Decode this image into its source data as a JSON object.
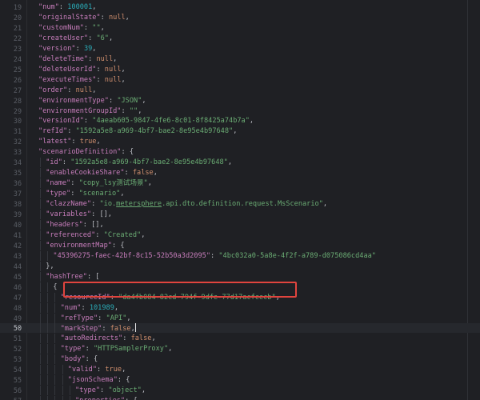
{
  "editor": {
    "language": "JSON",
    "current_line": 50,
    "lines": [
      {
        "n": 19,
        "indent": 0,
        "tokens": [
          [
            "k",
            "\"num\""
          ],
          [
            "p",
            ": "
          ],
          [
            "n",
            "100001"
          ],
          [
            "p",
            ","
          ]
        ]
      },
      {
        "n": 20,
        "indent": 0,
        "tokens": [
          [
            "k",
            "\"originalState\""
          ],
          [
            "p",
            ": "
          ],
          [
            "kw",
            "null"
          ],
          [
            "p",
            ","
          ]
        ]
      },
      {
        "n": 21,
        "indent": 0,
        "tokens": [
          [
            "k",
            "\"customNum\""
          ],
          [
            "p",
            ": "
          ],
          [
            "s",
            "\"\""
          ],
          [
            "p",
            ","
          ]
        ]
      },
      {
        "n": 22,
        "indent": 0,
        "tokens": [
          [
            "k",
            "\"createUser\""
          ],
          [
            "p",
            ": "
          ],
          [
            "s",
            "\"6\""
          ],
          [
            "p",
            ","
          ]
        ]
      },
      {
        "n": 23,
        "indent": 0,
        "tokens": [
          [
            "k",
            "\"version\""
          ],
          [
            "p",
            ": "
          ],
          [
            "n",
            "39"
          ],
          [
            "p",
            ","
          ]
        ]
      },
      {
        "n": 24,
        "indent": 0,
        "tokens": [
          [
            "k",
            "\"deleteTime\""
          ],
          [
            "p",
            ": "
          ],
          [
            "kw",
            "null"
          ],
          [
            "p",
            ","
          ]
        ]
      },
      {
        "n": 25,
        "indent": 0,
        "tokens": [
          [
            "k",
            "\"deleteUserId\""
          ],
          [
            "p",
            ": "
          ],
          [
            "kw",
            "null"
          ],
          [
            "p",
            ","
          ]
        ]
      },
      {
        "n": 26,
        "indent": 0,
        "tokens": [
          [
            "k",
            "\"executeTimes\""
          ],
          [
            "p",
            ": "
          ],
          [
            "kw",
            "null"
          ],
          [
            "p",
            ","
          ]
        ]
      },
      {
        "n": 27,
        "indent": 0,
        "tokens": [
          [
            "k",
            "\"order\""
          ],
          [
            "p",
            ": "
          ],
          [
            "kw",
            "null"
          ],
          [
            "p",
            ","
          ]
        ]
      },
      {
        "n": 28,
        "indent": 0,
        "tokens": [
          [
            "k",
            "\"environmentType\""
          ],
          [
            "p",
            ": "
          ],
          [
            "s",
            "\"JSON\""
          ],
          [
            "p",
            ","
          ]
        ]
      },
      {
        "n": 29,
        "indent": 0,
        "tokens": [
          [
            "k",
            "\"environmentGroupId\""
          ],
          [
            "p",
            ": "
          ],
          [
            "s",
            "\"\""
          ],
          [
            "p",
            ","
          ]
        ]
      },
      {
        "n": 30,
        "indent": 0,
        "tokens": [
          [
            "k",
            "\"versionId\""
          ],
          [
            "p",
            ": "
          ],
          [
            "s",
            "\"4aeab605-9847-4fe6-8c01-8f8425a74b7a\""
          ],
          [
            "p",
            ","
          ]
        ]
      },
      {
        "n": 31,
        "indent": 0,
        "tokens": [
          [
            "k",
            "\"refId\""
          ],
          [
            "p",
            ": "
          ],
          [
            "s",
            "\"1592a5e8-a969-4bf7-bae2-8e95e4b97648\""
          ],
          [
            "p",
            ","
          ]
        ]
      },
      {
        "n": 32,
        "indent": 0,
        "tokens": [
          [
            "k",
            "\"latest\""
          ],
          [
            "p",
            ": "
          ],
          [
            "kw",
            "true"
          ],
          [
            "p",
            ","
          ]
        ]
      },
      {
        "n": 33,
        "indent": 0,
        "tokens": [
          [
            "k",
            "\"scenarioDefinition\""
          ],
          [
            "p",
            ": {"
          ]
        ]
      },
      {
        "n": 34,
        "indent": 1,
        "tokens": [
          [
            "k",
            "\"id\""
          ],
          [
            "p",
            ": "
          ],
          [
            "s",
            "\"1592a5e8-a969-4bf7-bae2-8e95e4b97648\""
          ],
          [
            "p",
            ","
          ]
        ]
      },
      {
        "n": 35,
        "indent": 1,
        "tokens": [
          [
            "k",
            "\"enableCookieShare\""
          ],
          [
            "p",
            ": "
          ],
          [
            "kw",
            "false"
          ],
          [
            "p",
            ","
          ]
        ]
      },
      {
        "n": 36,
        "indent": 1,
        "tokens": [
          [
            "k",
            "\"name\""
          ],
          [
            "p",
            ": "
          ],
          [
            "s",
            "\"copy_lsy测试场景\""
          ],
          [
            "p",
            ","
          ]
        ]
      },
      {
        "n": 37,
        "indent": 1,
        "tokens": [
          [
            "k",
            "\"type\""
          ],
          [
            "p",
            ": "
          ],
          [
            "s",
            "\"scenario\""
          ],
          [
            "p",
            ","
          ]
        ]
      },
      {
        "n": 38,
        "indent": 1,
        "tokens": [
          [
            "k",
            "\"clazzName\""
          ],
          [
            "p",
            ": "
          ],
          [
            "s",
            "\"io."
          ],
          [
            "su",
            "metersphere"
          ],
          [
            "s",
            ".api.dto.definition.request.MsScenario\""
          ],
          [
            "p",
            ","
          ]
        ]
      },
      {
        "n": 39,
        "indent": 1,
        "tokens": [
          [
            "k",
            "\"variables\""
          ],
          [
            "p",
            ": [],"
          ]
        ]
      },
      {
        "n": 40,
        "indent": 1,
        "tokens": [
          [
            "k",
            "\"headers\""
          ],
          [
            "p",
            ": [],"
          ]
        ]
      },
      {
        "n": 41,
        "indent": 1,
        "tokens": [
          [
            "k",
            "\"referenced\""
          ],
          [
            "p",
            ": "
          ],
          [
            "s",
            "\"Created\""
          ],
          [
            "p",
            ","
          ]
        ]
      },
      {
        "n": 42,
        "indent": 1,
        "tokens": [
          [
            "k",
            "\"environmentMap\""
          ],
          [
            "p",
            ": {"
          ]
        ]
      },
      {
        "n": 43,
        "indent": 2,
        "tokens": [
          [
            "k",
            "\"45396275-faec-42bf-8c15-52b50a3d2095\""
          ],
          [
            "p",
            ": "
          ],
          [
            "s",
            "\"4bc032a0-5a8e-4f2f-a789-d075086cd4aa\""
          ]
        ]
      },
      {
        "n": 44,
        "indent": 1,
        "tokens": [
          [
            "p",
            "},"
          ]
        ]
      },
      {
        "n": 45,
        "indent": 1,
        "tokens": [
          [
            "k",
            "\"hashTree\""
          ],
          [
            "p",
            ": ["
          ]
        ]
      },
      {
        "n": 46,
        "indent": 2,
        "tokens": [
          [
            "p",
            "{"
          ]
        ]
      },
      {
        "n": 47,
        "indent": 3,
        "tokens": [
          [
            "k",
            "\"resourceId\""
          ],
          [
            "p",
            ": "
          ],
          [
            "s",
            "\"da4fb084-82cd-794f-9dfe-77d17acfcecb\""
          ],
          [
            "p",
            ","
          ]
        ]
      },
      {
        "n": 48,
        "indent": 3,
        "tokens": [
          [
            "k",
            "\"num\""
          ],
          [
            "p",
            ": "
          ],
          [
            "n",
            "101989"
          ],
          [
            "p",
            ","
          ]
        ]
      },
      {
        "n": 49,
        "indent": 3,
        "tokens": [
          [
            "k",
            "\"refType\""
          ],
          [
            "p",
            ": "
          ],
          [
            "s",
            "\"API\""
          ],
          [
            "p",
            ","
          ]
        ]
      },
      {
        "n": 50,
        "indent": 3,
        "tokens": [
          [
            "k",
            "\"markStep\""
          ],
          [
            "p",
            ": "
          ],
          [
            "kw",
            "false"
          ],
          [
            "p",
            ","
          ]
        ]
      },
      {
        "n": 51,
        "indent": 3,
        "tokens": [
          [
            "k",
            "\"autoRedirects\""
          ],
          [
            "p",
            ": "
          ],
          [
            "kw",
            "false"
          ],
          [
            "p",
            ","
          ]
        ]
      },
      {
        "n": 52,
        "indent": 3,
        "tokens": [
          [
            "k",
            "\"type\""
          ],
          [
            "p",
            ": "
          ],
          [
            "s",
            "\"HTTPSamplerProxy\""
          ],
          [
            "p",
            ","
          ]
        ]
      },
      {
        "n": 53,
        "indent": 3,
        "tokens": [
          [
            "k",
            "\"body\""
          ],
          [
            "p",
            ": {"
          ]
        ]
      },
      {
        "n": 54,
        "indent": 4,
        "tokens": [
          [
            "k",
            "\"valid\""
          ],
          [
            "p",
            ": "
          ],
          [
            "kw",
            "true"
          ],
          [
            "p",
            ","
          ]
        ]
      },
      {
        "n": 55,
        "indent": 4,
        "tokens": [
          [
            "k",
            "\"jsonSchema\""
          ],
          [
            "p",
            ": {"
          ]
        ]
      },
      {
        "n": 56,
        "indent": 5,
        "tokens": [
          [
            "k",
            "\"type\""
          ],
          [
            "p",
            ": "
          ],
          [
            "s",
            "\"object\""
          ],
          [
            "p",
            ","
          ]
        ]
      },
      {
        "n": 57,
        "indent": 5,
        "tokens": [
          [
            "k",
            "\"properties\""
          ],
          [
            "p",
            ": {"
          ]
        ]
      }
    ]
  },
  "colors": {
    "background": "#1f2024",
    "key": "#c77dbb",
    "string": "#6aab73",
    "number": "#2aacb8",
    "keyword": "#cf8e6d",
    "highlight_box": "#e0443e"
  }
}
